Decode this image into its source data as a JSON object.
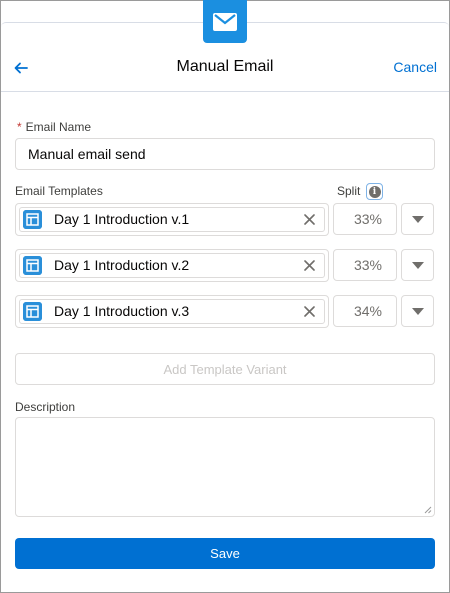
{
  "header": {
    "title": "Manual Email",
    "cancel_label": "Cancel",
    "back_icon": "arrow-left-icon",
    "badge_icon": "email-icon"
  },
  "form": {
    "email_name": {
      "required_marker": "*",
      "label": "Email Name",
      "value": "Manual email send"
    },
    "templates_label": "Email Templates",
    "split_label": "Split",
    "templates": [
      {
        "name": "Day 1 Introduction v.1",
        "split": "33%"
      },
      {
        "name": "Day 1 Introduction v.2",
        "split": "33%"
      },
      {
        "name": "Day 1 Introduction v.3",
        "split": "34%"
      }
    ],
    "add_variant_label": "Add Template Variant",
    "description_label": "Description",
    "description_value": "",
    "save_label": "Save"
  },
  "colors": {
    "brand": "#0070d2",
    "badge": "#1b8fe0",
    "template_icon": "#2a8fd9",
    "required": "#c23934"
  }
}
